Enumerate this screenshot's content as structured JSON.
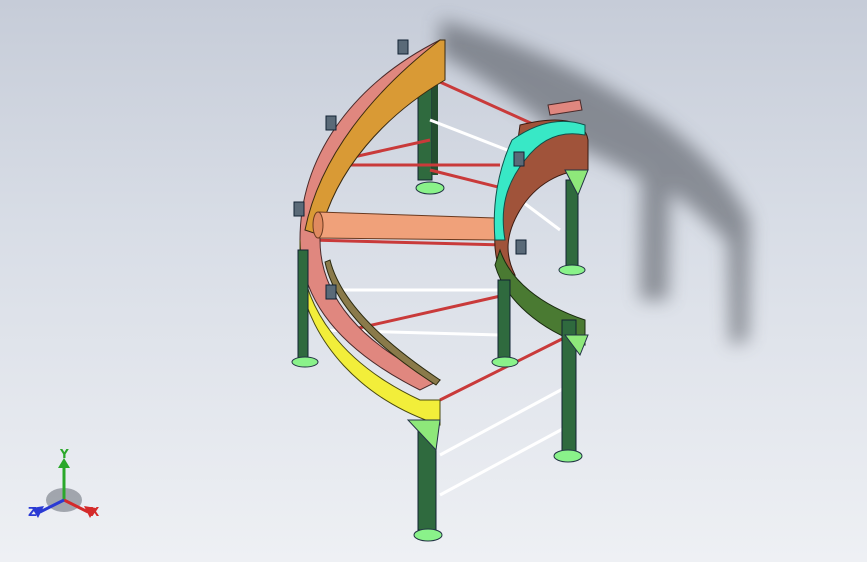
{
  "viewport": {
    "background_top": "#c6ccd8",
    "background_bottom": "#eef0f4"
  },
  "model": {
    "colors": {
      "outer_rail_top": "#e0877f",
      "outer_side_plate": "#d99a35",
      "outer_side_plate_lower": "#f2ee3a",
      "inner_side_plate": "#a0533a",
      "inner_rail": "#38e8c6",
      "legs": "#2f6a3e",
      "feet": "#8af28a",
      "roller": "#f0a17a",
      "cross_bars": "#c93a3a",
      "white_bars": "#ffffff",
      "gussets": "#8ee87a",
      "guide_rail": "#8a7a4a"
    }
  },
  "triad": {
    "x_label": "X",
    "y_label": "Y",
    "z_label": "Z",
    "x_color": "#d42a2a",
    "y_color": "#2aa82a",
    "z_color": "#2a3ad4"
  }
}
